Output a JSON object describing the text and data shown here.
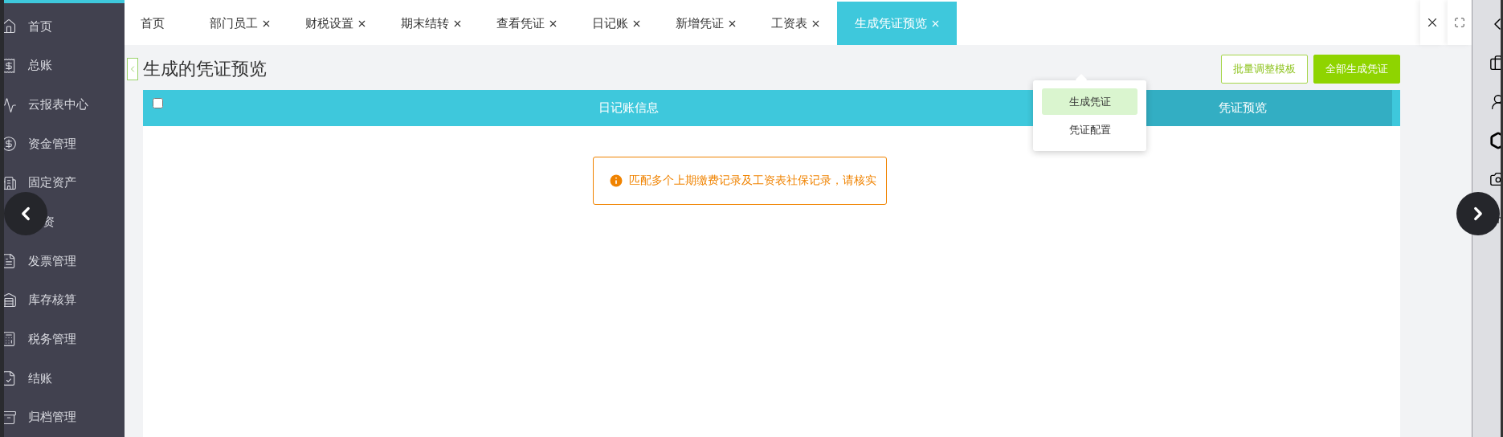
{
  "sidebar": {
    "items": [
      {
        "label": "首页"
      },
      {
        "label": "总账"
      },
      {
        "label": "云报表中心"
      },
      {
        "label": "资金管理"
      },
      {
        "label": "固定资产"
      },
      {
        "label": "资"
      },
      {
        "label": "发票管理"
      },
      {
        "label": "库存核算"
      },
      {
        "label": "税务管理"
      },
      {
        "label": "结账"
      },
      {
        "label": "归档管理"
      }
    ]
  },
  "tabs": [
    {
      "label": "首页",
      "closable": false,
      "selected": false
    },
    {
      "label": "部门员工",
      "closable": true,
      "selected": false
    },
    {
      "label": "财税设置",
      "closable": true,
      "selected": false
    },
    {
      "label": "期末结转",
      "closable": true,
      "selected": false
    },
    {
      "label": "查看凭证",
      "closable": true,
      "selected": false
    },
    {
      "label": "日记账",
      "closable": true,
      "selected": false
    },
    {
      "label": "新增凭证",
      "closable": true,
      "selected": false
    },
    {
      "label": "工资表",
      "closable": true,
      "selected": false
    },
    {
      "label": "生成凭证预览",
      "closable": true,
      "selected": true
    }
  ],
  "page": {
    "title": "生成的凭证预览",
    "buttons": [
      {
        "label": "批量调整模板",
        "kind": "outline"
      },
      {
        "label": "全部生成凭证",
        "kind": "primary"
      }
    ],
    "menu": [
      {
        "label": "生成凭证",
        "selected": true
      },
      {
        "label": "凭证配置",
        "selected": false
      }
    ],
    "table": {
      "select_all": {
        "checked": false
      },
      "columns": [
        {
          "label": "日记账信息",
          "color": "#3ec8dc"
        },
        {
          "label": "凭证预览",
          "color": "#33aec3"
        }
      ]
    },
    "alert": {
      "message": "匹配多个上期缴费记录及工资表社保记录，请核实"
    }
  }
}
